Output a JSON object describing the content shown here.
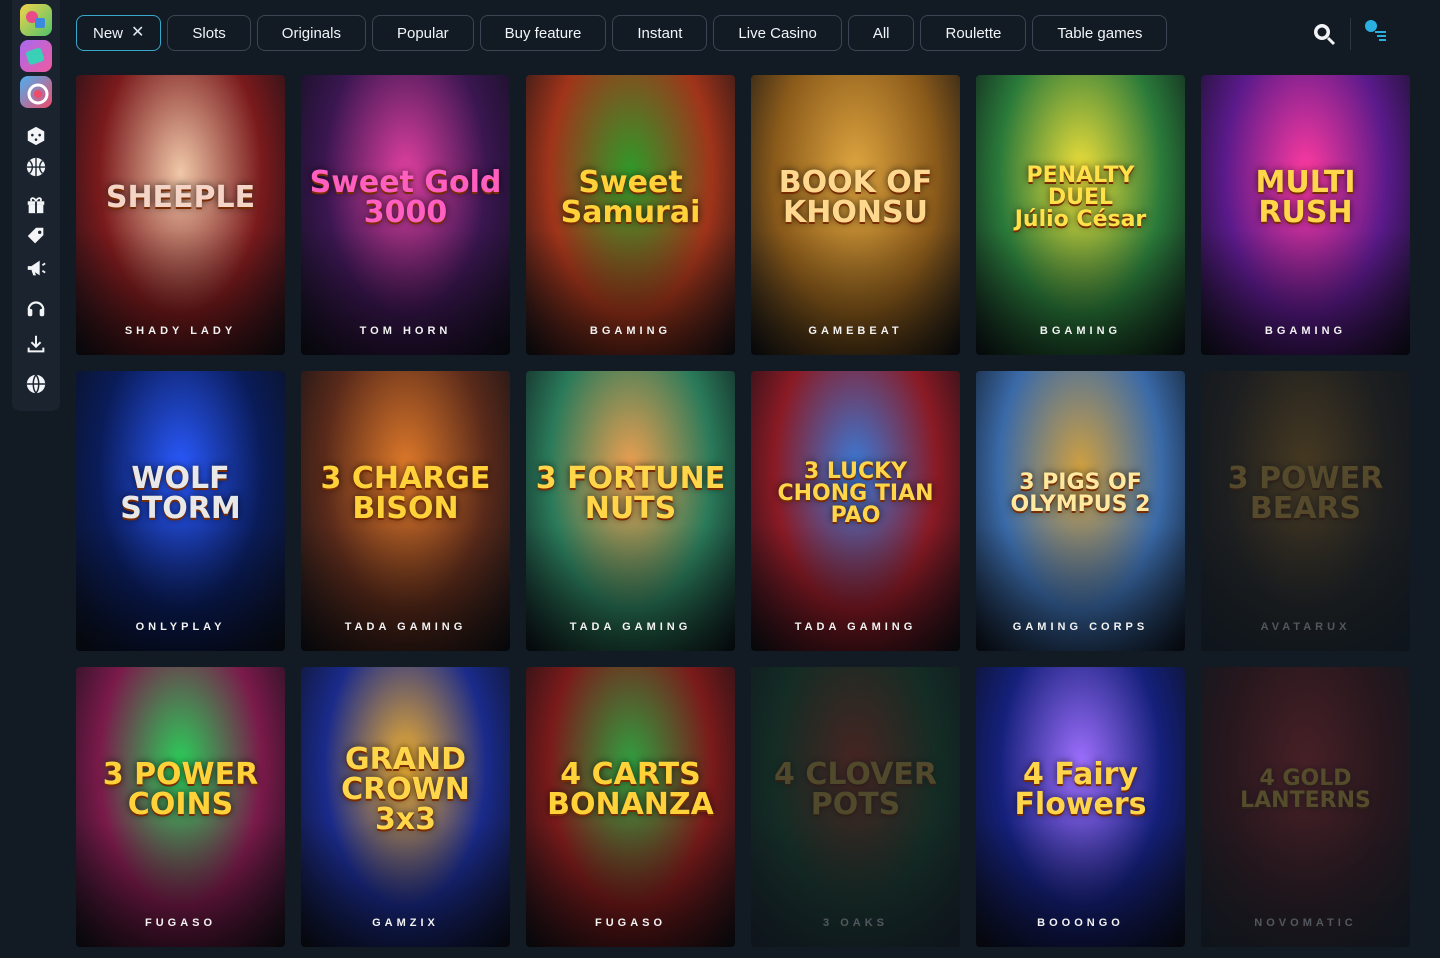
{
  "sidebar": {
    "apps": [
      {
        "name": "casino-app-icon"
      },
      {
        "name": "sport-app-icon"
      },
      {
        "name": "lottery-app-icon"
      }
    ],
    "icons": [
      "dice-icon",
      "basketball-icon",
      "gift-icon",
      "tag-icon",
      "megaphone-icon",
      "headphones-icon",
      "download-icon",
      "globe-icon"
    ]
  },
  "filters": [
    {
      "label": "New",
      "active": true
    },
    {
      "label": "Slots"
    },
    {
      "label": "Originals"
    },
    {
      "label": "Popular"
    },
    {
      "label": "Buy feature"
    },
    {
      "label": "Instant"
    },
    {
      "label": "Live Casino"
    },
    {
      "label": "All"
    },
    {
      "label": "Roulette"
    },
    {
      "label": "Table games"
    }
  ],
  "header": {
    "search_icon": "search-icon",
    "profile_icon": "profile-icon",
    "notification_count": "1"
  },
  "games": [
    {
      "title": "SHEEPLE",
      "provider": "SHADY LADY",
      "bg": "#7a1a1c",
      "accent": "#f0c8a8",
      "title_color": "#f4d4c6"
    },
    {
      "title": "Sweet Gold\n3000",
      "provider": "TOM HORN",
      "bg": "#3a1650",
      "accent": "#e040a0",
      "title_color": "#ff5fc0"
    },
    {
      "title": "Sweet\nSamurai",
      "provider": "BGAMING",
      "bg": "#a0341a",
      "accent": "#2f9a2a",
      "title_color": "#ffd23a"
    },
    {
      "title": "BOOK OF KHONSU",
      "provider": "GAMEBEAT",
      "bg": "#8a5a1a",
      "accent": "#e0a640",
      "title_color": "#ffd890"
    },
    {
      "title": "PENALTY\nDUEL\nJúlio César",
      "provider": "BGAMING",
      "bg": "#2a7a3a",
      "accent": "#f1e03a",
      "title_color": "#ffe14a"
    },
    {
      "title": "MULTI\nRUSH",
      "provider": "BGAMING",
      "bg": "#5a1a8a",
      "accent": "#ff3aa0",
      "title_color": "#ffd54a"
    },
    {
      "title": "WOLF STORM",
      "provider": "ONLYPLAY",
      "bg": "#0a1c5a",
      "accent": "#2a5aff",
      "title_color": "#e8e8e8"
    },
    {
      "title": "3 CHARGE\nBISON",
      "provider": "TADA GAMING",
      "bg": "#5a2a1a",
      "accent": "#e07a2a",
      "title_color": "#ffd23a"
    },
    {
      "title": "3 FORTUNE\nNUTS",
      "provider": "TADA GAMING",
      "bg": "#2a7a5a",
      "accent": "#f0a050",
      "title_color": "#ffd54a"
    },
    {
      "title": "3 LUCKY\nCHONG TIAN PAO",
      "provider": "TADA GAMING",
      "bg": "#8a1a24",
      "accent": "#3a7ad8",
      "title_color": "#ffd54a"
    },
    {
      "title": "3 PIGS OF\nOLYMPUS 2",
      "provider": "GAMING CORPS",
      "bg": "#3a6aa8",
      "accent": "#d0a040",
      "title_color": "#ffe8a0"
    },
    {
      "title": "3 POWER\nBEARS",
      "provider": "AVATARUX",
      "bg": "#3a2a18",
      "accent": "#d08a20",
      "title_color": "#ffc040",
      "dim": true
    },
    {
      "title": "3 POWER\nCOINS",
      "provider": "FUGASO",
      "bg": "#7a1a4a",
      "accent": "#2ad05a",
      "title_color": "#ffd23a"
    },
    {
      "title": "GRAND CROWN\n3x3",
      "provider": "GAMZIX",
      "bg": "#1a2a8a",
      "accent": "#f0b030",
      "title_color": "#ffd54a"
    },
    {
      "title": "4 CARTS\nBONANZA",
      "provider": "FUGASO",
      "bg": "#7a1a1a",
      "accent": "#30a040",
      "title_color": "#ffd23a"
    },
    {
      "title": "4 CLOVER\nPOTS",
      "provider": "3 OAKS",
      "bg": "#1a5a2a",
      "accent": "#d04020",
      "title_color": "#f0c040",
      "dim": true
    },
    {
      "title": "4 Fairy\nFlowers",
      "provider": "BOOONGO",
      "bg": "#14207a",
      "accent": "#a070ff",
      "title_color": "#ffd54a"
    },
    {
      "title": "4 GOLD LANTERNS",
      "provider": "NOVOMATIC",
      "bg": "#5a1010",
      "accent": "#d03030",
      "title_color": "#ffcc40",
      "dim": true
    }
  ]
}
